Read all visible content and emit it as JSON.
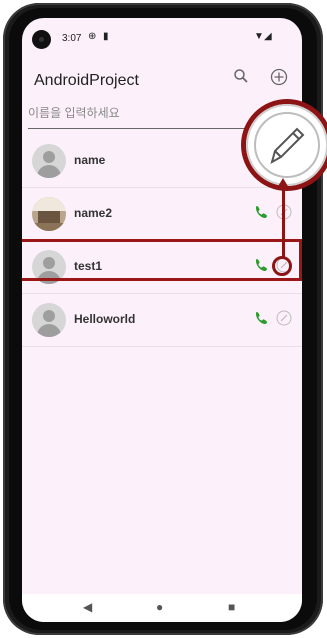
{
  "status": {
    "time": "3:07"
  },
  "appbar": {
    "title": "AndroidProject"
  },
  "search": {
    "placeholder": "이름을 입력하세요"
  },
  "contacts": [
    {
      "name": "name",
      "avatar": "default"
    },
    {
      "name": "name2",
      "avatar": "photo"
    },
    {
      "name": "test1",
      "avatar": "default"
    },
    {
      "name": "Helloworld",
      "avatar": "default"
    }
  ],
  "colors": {
    "accent": "#9b1616",
    "call": "#2e9b2e",
    "screen_bg": "#fcf1fb"
  },
  "icons": {
    "search": "search-icon",
    "add": "add-contact-icon",
    "call": "phone-icon",
    "edit": "pencil-icon"
  }
}
